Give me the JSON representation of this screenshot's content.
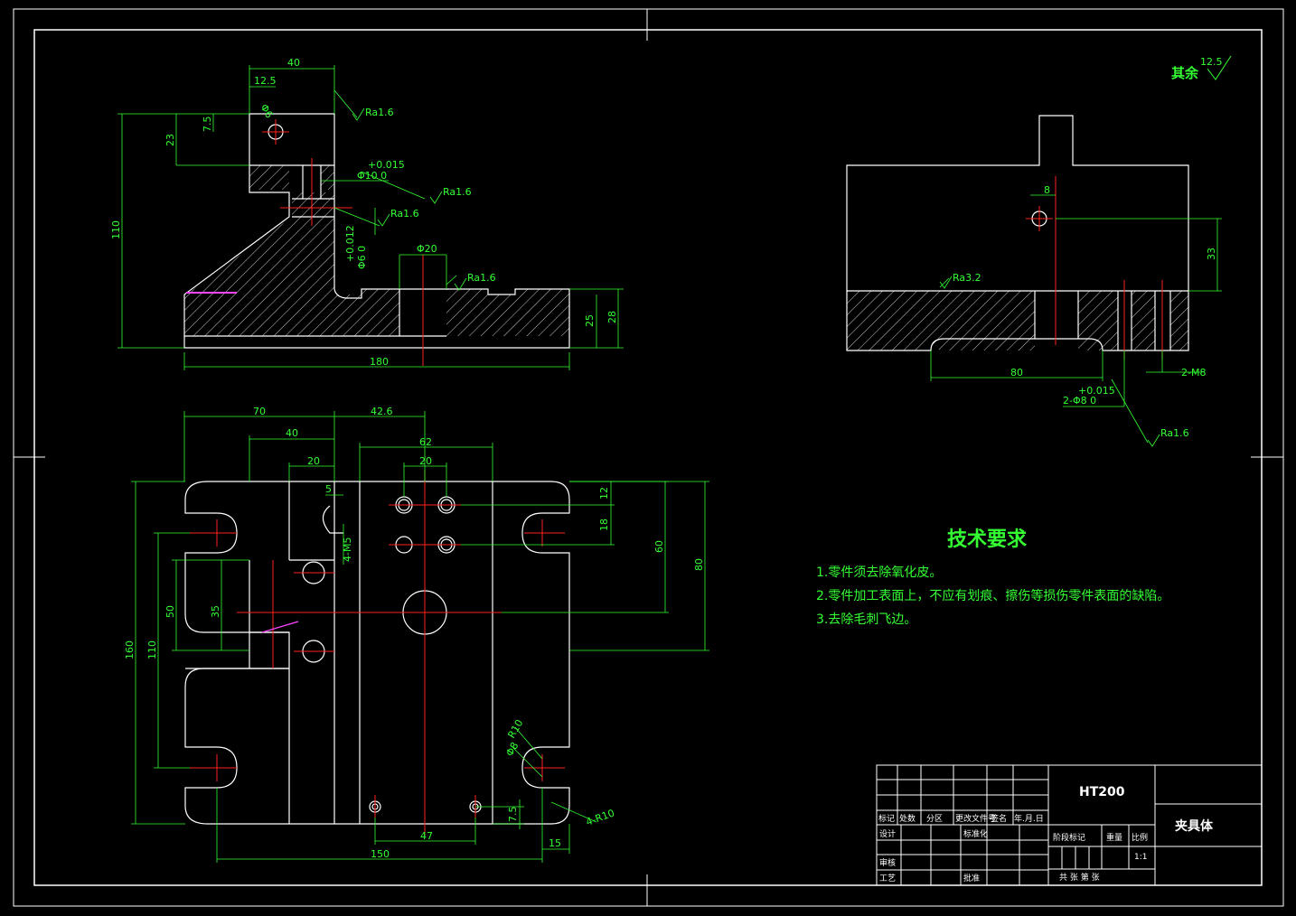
{
  "roughness_note": {
    "prefix": "其余",
    "value": "12.5"
  },
  "front_view": {
    "dims": [
      "40",
      "12.5",
      "Φ6",
      "7.5",
      "23",
      "110",
      "+0.015",
      "Φ10 0",
      "+0.012",
      "Φ6 0",
      "Φ20",
      "25",
      "28",
      "180"
    ],
    "roughness": [
      "Ra1.6",
      "Ra1.6",
      "Ra1.6",
      "Ra1.6"
    ]
  },
  "side_view": {
    "dims": [
      "8",
      "33",
      "80",
      "+0.015",
      "2-Φ8 0",
      "2-M8"
    ],
    "roughness": [
      "Ra3.2",
      "Ra1.6"
    ]
  },
  "top_view": {
    "dims": [
      "70",
      "40",
      "42.6",
      "62",
      "20",
      "20",
      "5",
      "4-M5",
      "12",
      "18",
      "60",
      "80",
      "50",
      "35",
      "110",
      "160",
      "R10",
      "Φ8",
      "7.5",
      "47",
      "150",
      "15",
      "4-R10"
    ]
  },
  "tech_requirements": {
    "title": "技术要求",
    "items": [
      "1.零件须去除氧化皮。",
      "2.零件加工表面上，不应有划痕、擦伤等损伤零件表面的缺陷。",
      "3.去除毛刺飞边。"
    ]
  },
  "title_block": {
    "material": "HT200",
    "part_name": "夹具体",
    "scale": "1:1",
    "labels": {
      "mark": "标记",
      "count": "处数",
      "zone": "分区",
      "change_doc": "更改文件号",
      "signature": "签名",
      "date": "年.月.日",
      "design": "设计",
      "standardize": "标准化",
      "stage_mark": "阶段标记",
      "weight": "重量",
      "ratio": "比例",
      "review": "审核",
      "process": "工艺",
      "approve": "批准",
      "sheets": "共 张 第 张"
    }
  },
  "colors": {
    "background": "#000000",
    "outline": "#ffffff",
    "dimension": "#33ff33",
    "centerline": "#ff2222",
    "accent": "#ff44ff"
  }
}
